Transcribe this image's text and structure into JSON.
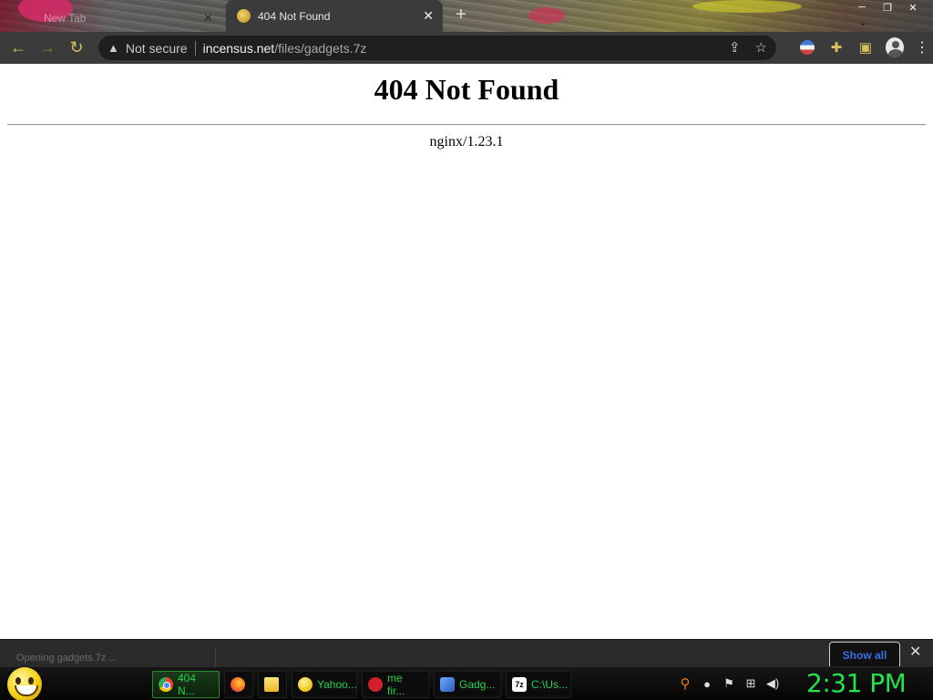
{
  "browser": {
    "tabs": [
      {
        "label": "New Tab",
        "active": false
      },
      {
        "label": "404 Not Found",
        "active": true
      }
    ],
    "new_tab_symbol": "+",
    "security_label": "Not secure",
    "url_host": "incensus.net",
    "url_path": "/files/gadgets.7z",
    "icons": {
      "back": "arrow-left-icon",
      "forward": "arrow-right-icon",
      "reload": "reload-icon",
      "share": "share-icon",
      "bookmark": "star-icon",
      "extensions": "puzzle-icon",
      "side_panel": "side-panel-icon",
      "profile": "profile-icon",
      "menu": "kebab-menu-icon"
    }
  },
  "page": {
    "title": "404 Not Found",
    "server": "nginx/1.23.1"
  },
  "download_shelf": {
    "item_text": "Opening gadgets.7z ...",
    "show_all_label": "Show all"
  },
  "taskbar": {
    "items": [
      {
        "label": "404 N...",
        "icon": "chrome-icon",
        "active": true
      },
      {
        "label": "",
        "icon": "firefox-icon",
        "active": false
      },
      {
        "label": "",
        "icon": "folder-icon",
        "active": false
      },
      {
        "label": "Yahoo...",
        "icon": "yahoo-messenger-icon",
        "active": false
      },
      {
        "label": "me fir...",
        "icon": "red-app-icon",
        "active": false
      },
      {
        "label": "Gadg...",
        "icon": "gadget-icon",
        "active": false
      },
      {
        "label": "C:\\Us...",
        "icon": "7zip-icon",
        "active": false
      }
    ],
    "clock": "2:31 PM"
  },
  "colors": {
    "accent_green": "#24d24a",
    "toolbar_bg": "#3b3b3b",
    "icon_gold": "#d8c25a",
    "show_all_blue": "#3b6fe6"
  }
}
